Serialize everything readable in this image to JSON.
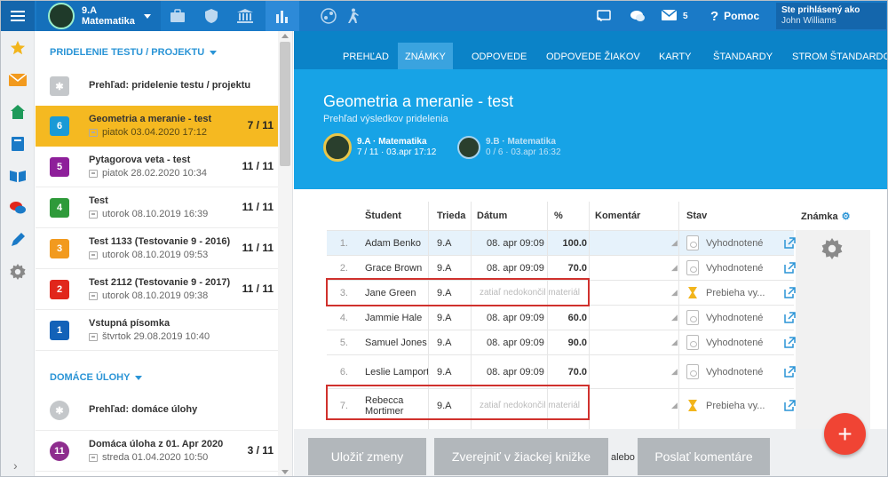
{
  "topbar": {
    "class_name": "9.A",
    "subject": "Matematika",
    "messages_count": "5",
    "help_label": "Pomoc",
    "signed_in_label": "Ste prihlásený ako",
    "user_name": "John Williams"
  },
  "sidebar": {
    "section_tests": "PRIDELENIE TESTU / PROJEKTU",
    "section_homework": "DOMÁCE ÚLOHY",
    "overview_tests": "Prehľad: pridelenie testu / projektu",
    "overview_homework": "Prehľad: domáce úlohy",
    "items": [
      {
        "num": "6",
        "title": "Geometria a meranie - test",
        "date": "piatok 03.04.2020 17:12",
        "score": "7 / 11",
        "color": "#1a9ad6"
      },
      {
        "num": "5",
        "title": "Pytagorova veta - test",
        "date": "piatok 28.02.2020 10:34",
        "score": "11 / 11",
        "color": "#8e1f9a"
      },
      {
        "num": "4",
        "title": "Test",
        "date": "utorok 08.10.2019 16:39",
        "score": "11 / 11",
        "color": "#2e9a3a"
      },
      {
        "num": "3",
        "title": "Test 1133 (Testovanie 9 - 2016)",
        "date": "utorok 08.10.2019 09:53",
        "score": "11 / 11",
        "color": "#f29a1e"
      },
      {
        "num": "2",
        "title": "Test 2112 (Testovanie 9 - 2017)",
        "date": "utorok 08.10.2019 09:38",
        "score": "11 / 11",
        "color": "#e1271c"
      },
      {
        "num": "1",
        "title": "Vstupná písomka",
        "date": "štvrtok 29.08.2019 10:40",
        "score": "",
        "color": "#1362b8"
      }
    ],
    "homework": [
      {
        "num": "11",
        "title": "Domáca úloha z 01. Apr 2020",
        "date": "streda 01.04.2020 10:50",
        "score": "3 / 11",
        "color": "#8e2d8e"
      }
    ]
  },
  "tabs": [
    "PREHĽAD",
    "ZNÁMKY",
    "ODPOVEDE",
    "ODPOVEDE ŽIAKOV",
    "KARTY",
    "ŠTANDARDY",
    "STROM ŠTANDARDOV"
  ],
  "hero": {
    "title": "Geometria a meranie - test",
    "subtitle": "Prehľad výsledkov pridelenia",
    "classes": [
      {
        "name": "9.A · Matematika",
        "info": "7 / 11 · 03.apr 17:12"
      },
      {
        "name": "9.B · Matematika",
        "info": "0 / 6 · 03.apr 16:32"
      }
    ]
  },
  "table": {
    "headers": {
      "student": "Študent",
      "trieda": "Trieda",
      "datum": "Dátum",
      "pct": "%",
      "komentar": "Komentár",
      "stav": "Stav",
      "znamka": "Známka"
    },
    "rows": [
      {
        "num": "1.",
        "name": "Adam Benko",
        "trieda": "9.A",
        "date": "08. apr 09:09",
        "pct": "100.0",
        "stav": "Vyhodnotené",
        "pending": ""
      },
      {
        "num": "2.",
        "name": "Grace Brown",
        "trieda": "9.A",
        "date": "08. apr 09:09",
        "pct": "70.0",
        "stav": "Vyhodnotené",
        "pending": ""
      },
      {
        "num": "3.",
        "name": "Jane Green",
        "trieda": "9.A",
        "date": "",
        "pct": "",
        "stav": "Prebieha vy...",
        "pending": "zatiaľ nedokončil materiál"
      },
      {
        "num": "4.",
        "name": "Jammie Hale",
        "trieda": "9.A",
        "date": "08. apr 09:09",
        "pct": "60.0",
        "stav": "Vyhodnotené",
        "pending": ""
      },
      {
        "num": "5.",
        "name": "Samuel Jones",
        "trieda": "9.A",
        "date": "08. apr 09:09",
        "pct": "90.0",
        "stav": "Vyhodnotené",
        "pending": ""
      },
      {
        "num": "6.",
        "name": "Leslie Lamport",
        "trieda": "9.A",
        "date": "08. apr 09:09",
        "pct": "70.0",
        "stav": "Vyhodnotené",
        "pending": ""
      },
      {
        "num": "7.",
        "name": "Rebecca Mortimer",
        "trieda": "9.A",
        "date": "",
        "pct": "",
        "stav": "Prebieha vy...",
        "pending": "zatiaľ nedokončil materiál"
      }
    ]
  },
  "actions": {
    "save": "Uložiť zmeny",
    "publish": "Zverejniť v žiackej knižke",
    "or": "alebo",
    "send_comments": "Poslať komentáre",
    "fab": "+"
  },
  "colors": {
    "brand": "#1a7ac7",
    "selected": "#f5b921",
    "hero": "#17a3e6",
    "fab": "#f04434",
    "highlight": "#d0312d"
  }
}
